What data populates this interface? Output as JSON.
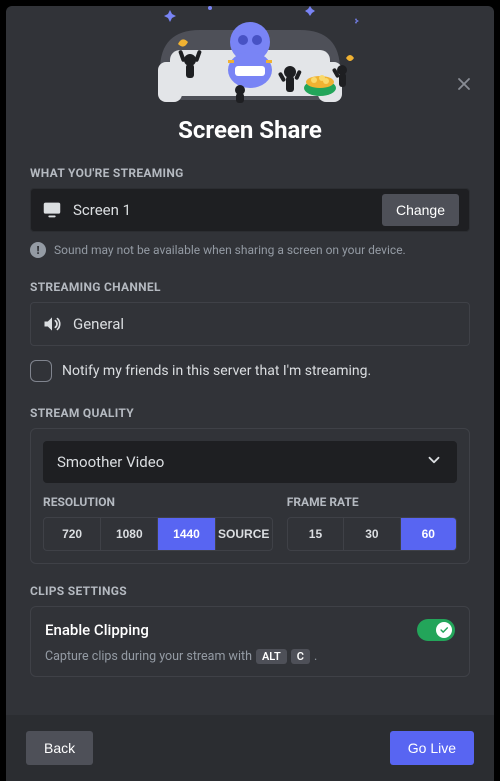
{
  "title": "Screen Share",
  "streaming": {
    "label": "WHAT YOU'RE STREAMING",
    "source": "Screen 1",
    "change": "Change",
    "warning": "Sound may not be available when sharing a screen on your device."
  },
  "channel": {
    "label": "STREAMING CHANNEL",
    "name": "General"
  },
  "notify": {
    "text": "Notify my friends in this server that I'm streaming.",
    "checked": false
  },
  "quality": {
    "label": "STREAM QUALITY",
    "preset": "Smoother Video",
    "resolution": {
      "label": "RESOLUTION",
      "options": [
        "720",
        "1080",
        "1440",
        "SOURCE"
      ],
      "selected": "1440"
    },
    "framerate": {
      "label": "FRAME RATE",
      "options": [
        "15",
        "30",
        "60"
      ],
      "selected": "60"
    }
  },
  "clips": {
    "label": "CLIPS SETTINGS",
    "title": "Enable Clipping",
    "enabled": true,
    "desc_prefix": "Capture clips during your stream with",
    "key1": "ALT",
    "key2": "C",
    "desc_suffix": "."
  },
  "footer": {
    "back": "Back",
    "golive": "Go Live"
  }
}
